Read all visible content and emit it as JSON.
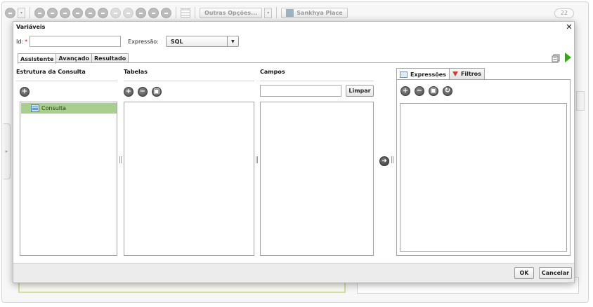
{
  "background": {
    "toolbar": {
      "more_options_label": "Outras Opções...",
      "place_label": "Sankhya Place",
      "pager_value": "22"
    }
  },
  "dialog": {
    "title": "Variáveis",
    "close_icon": "close-icon",
    "id_label": "Id:",
    "id_required_mark": "*",
    "id_value": "",
    "expression_label": "Expressão:",
    "expression_value": "SQL",
    "tabs": [
      {
        "label": "Assistente",
        "active": true
      },
      {
        "label": "Avançado",
        "active": false
      },
      {
        "label": "Resultado",
        "active": false
      }
    ],
    "columns": {
      "estrutura": {
        "title": "Estrutura da Consulta",
        "tree": [
          {
            "label": "Consulta",
            "selected": true,
            "icon": "query-icon"
          }
        ]
      },
      "tabelas": {
        "title": "Tabelas"
      },
      "campos": {
        "title": "Campos",
        "filter_value": "",
        "clear_label": "Limpar"
      }
    },
    "right_tabs": [
      {
        "label": "Expressões",
        "icon": "table-icon",
        "active": true
      },
      {
        "label": "Filtros",
        "icon": "filter-icon",
        "active": false
      }
    ],
    "ok_label": "OK",
    "cancel_label": "Cancelar",
    "colors": {
      "tree_selected": "#a9cf8f",
      "run_arrow": "#3aa51a",
      "required": "#dd0000"
    }
  }
}
